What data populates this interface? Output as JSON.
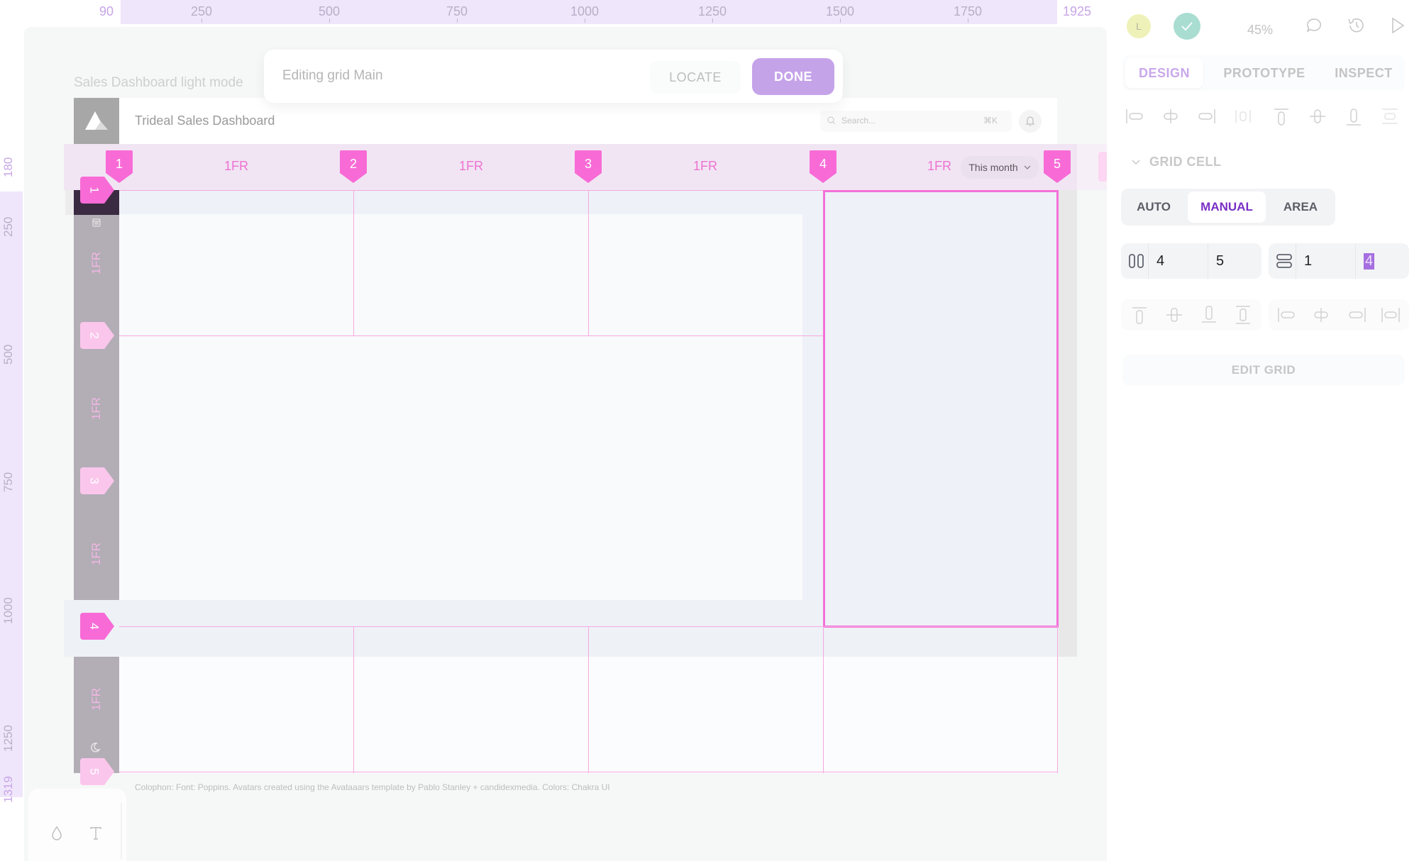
{
  "rulers": {
    "top": [
      {
        "label": "90",
        "edge": true
      },
      {
        "label": "250"
      },
      {
        "label": "500"
      },
      {
        "label": "750"
      },
      {
        "label": "1000"
      },
      {
        "label": "1250"
      },
      {
        "label": "1500"
      },
      {
        "label": "1750"
      },
      {
        "label": "1925",
        "edge": true
      }
    ],
    "left": [
      {
        "label": "180",
        "edge": true
      },
      {
        "label": "250"
      },
      {
        "label": "500"
      },
      {
        "label": "750"
      },
      {
        "label": "1000"
      },
      {
        "label": "1250"
      },
      {
        "label": "1319",
        "edge": true
      }
    ]
  },
  "canvas": {
    "frame_label": "Sales Dashboard light mode"
  },
  "toolbar": {
    "title": "Editing grid Main",
    "locate_label": "LOCATE",
    "done_label": "DONE"
  },
  "dashboard": {
    "title": "Trideal Sales Dashboard",
    "search_placeholder": "Search...",
    "search_shortcut": "⌘K",
    "period_select": "This month",
    "colophon": "Colophon: Font: Poppins. Avatars created using the Avataaars template by Pablo Stanley + candidexmedia. Colors: Chakra UI"
  },
  "grid": {
    "column_markers": [
      "1",
      "2",
      "3",
      "4",
      "5"
    ],
    "column_sizes": [
      "1FR",
      "1FR",
      "1FR",
      "1FR"
    ],
    "row_markers": [
      "1",
      "2",
      "3",
      "4",
      "5"
    ],
    "row_sizes": [
      "1FR",
      "1FR",
      "1FR",
      "1FR"
    ],
    "selected_cell": {
      "column_start": 4,
      "column_end": 5,
      "row_start": 1,
      "row_end": 4
    }
  },
  "panel": {
    "avatar_initial": "L",
    "zoom": "45%",
    "tabs": [
      {
        "label": "DESIGN",
        "active": true
      },
      {
        "label": "PROTOTYPE",
        "active": false
      },
      {
        "label": "INSPECT",
        "active": false
      }
    ],
    "section_title": "GRID CELL",
    "modes": [
      {
        "label": "AUTO",
        "active": false
      },
      {
        "label": "MANUAL",
        "active": true
      },
      {
        "label": "AREA",
        "active": false
      }
    ],
    "column_span": {
      "start": "4",
      "end": "5"
    },
    "row_span": {
      "start": "1",
      "end": "4"
    },
    "edit_grid_label": "EDIT GRID"
  },
  "colors": {
    "grid_pink": "#f471d8",
    "accent_purple": "#c5a3e9",
    "manual_purple": "#7a2fc4"
  }
}
